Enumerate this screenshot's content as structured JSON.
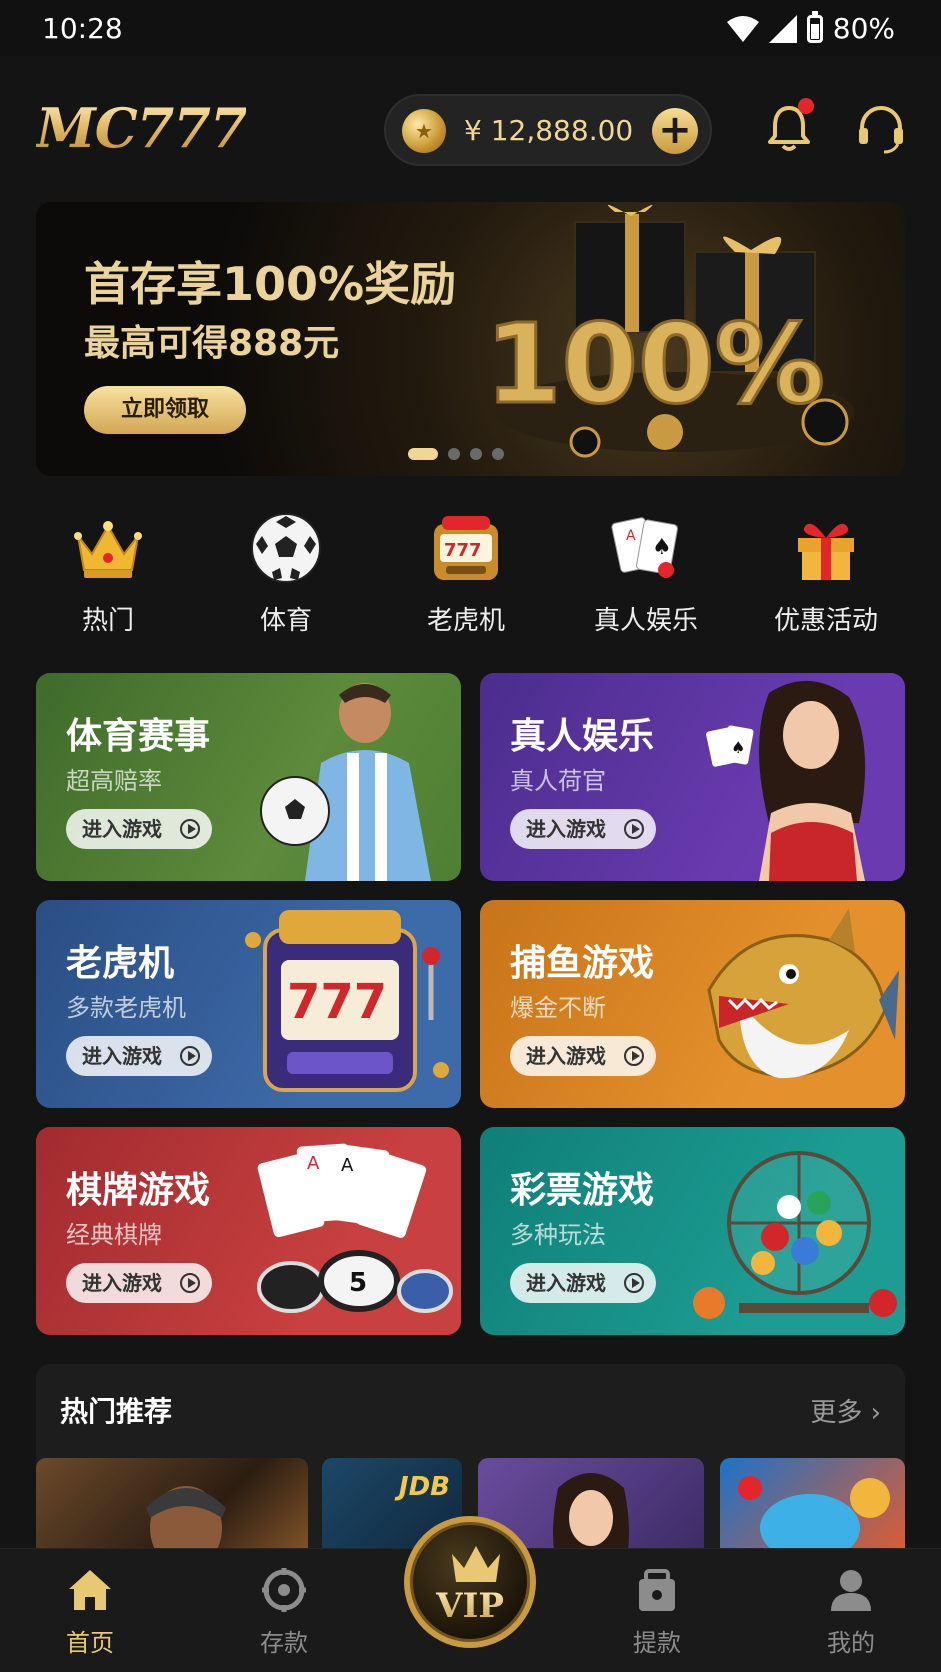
{
  "status_bar": {
    "time": "10:28",
    "battery": "80%"
  },
  "header": {
    "logo": "MC777",
    "balance": "¥ 12,888.00",
    "coin_icon": "coin-icon",
    "add_icon": "plus-icon",
    "notification_icon": "bell-icon",
    "service_icon": "headset-icon"
  },
  "banner": {
    "title": "首存享100%奖励",
    "subtitle": "最高可得888元",
    "cta": "立即领取",
    "graphic_text": "100%",
    "page_count": 4,
    "active_page": 1
  },
  "categories": [
    {
      "label": "热门",
      "icon": "crown-icon"
    },
    {
      "label": "体育",
      "icon": "soccer-ball-icon"
    },
    {
      "label": "老虎机",
      "icon": "slot-machine-icon"
    },
    {
      "label": "真人娱乐",
      "icon": "playing-cards-icon"
    },
    {
      "label": "优惠活动",
      "icon": "gift-icon"
    }
  ],
  "game_cards": [
    {
      "title": "体育赛事",
      "subtitle": "超高赔率",
      "button": "进入游戏"
    },
    {
      "title": "真人娱乐",
      "subtitle": "真人荷官",
      "button": "进入游戏"
    },
    {
      "title": "老虎机",
      "subtitle": "多款老虎机",
      "button": "进入游戏"
    },
    {
      "title": "捕鱼游戏",
      "subtitle": "爆金不断",
      "button": "进入游戏"
    },
    {
      "title": "棋牌游戏",
      "subtitle": "经典棋牌",
      "button": "进入游戏"
    },
    {
      "title": "彩票游戏",
      "subtitle": "多种玩法",
      "button": "进入游戏"
    }
  ],
  "hot_section": {
    "title": "热门推荐",
    "more": "更多",
    "thumb_brand": "JDB"
  },
  "bottom_nav": [
    {
      "label": "首页",
      "icon": "home-icon",
      "active": true
    },
    {
      "label": "存款",
      "icon": "deposit-icon",
      "active": false
    },
    {
      "label": "VIP",
      "icon": "vip-crown-icon",
      "active": false
    },
    {
      "label": "提款",
      "icon": "withdraw-icon",
      "active": false
    },
    {
      "label": "我的",
      "icon": "user-icon",
      "active": false
    }
  ],
  "colors": {
    "accent_gold": "#e9c873",
    "background": "#141414",
    "badge_red": "#e2262b"
  }
}
